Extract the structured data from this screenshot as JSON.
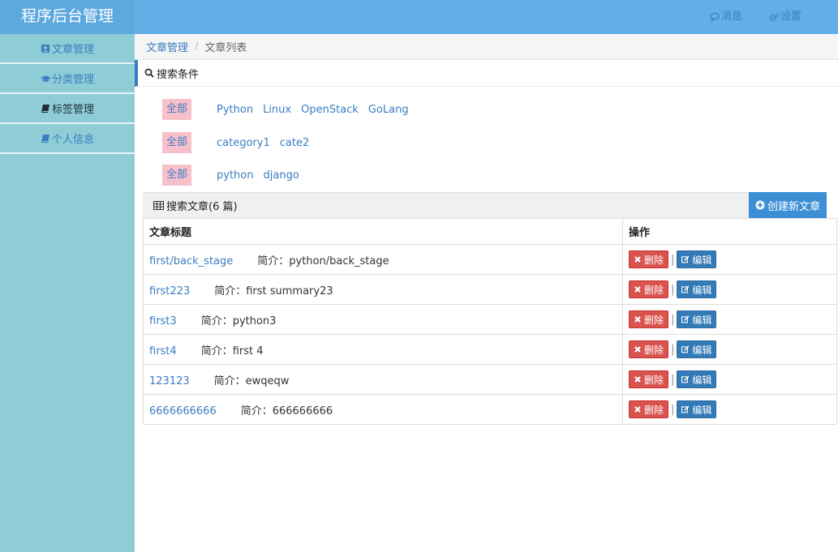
{
  "brand": {
    "title": "程序后台管理"
  },
  "sidebar": {
    "items": [
      {
        "label": "文章管理",
        "icon": "user-square-icon"
      },
      {
        "label": "分类管理",
        "icon": "graduation-cap-icon"
      },
      {
        "label": "标签管理",
        "icon": "book-icon"
      },
      {
        "label": "个人信息",
        "icon": "book-icon"
      }
    ]
  },
  "topbar": {
    "messages_label": "消息",
    "settings_label": "设置"
  },
  "breadcrumb": {
    "parent": "文章管理",
    "separator": "/",
    "current": "文章列表"
  },
  "search": {
    "title": "搜索条件",
    "rows": [
      {
        "all_label": "全部",
        "options": [
          "Python",
          "Linux",
          "OpenStack",
          "GoLang"
        ]
      },
      {
        "all_label": "全部",
        "options": [
          "category1",
          "cate2"
        ]
      },
      {
        "all_label": "全部",
        "options": [
          "python",
          "django"
        ]
      }
    ]
  },
  "article_table": {
    "bar_title": "搜索文章(6 篇)",
    "create_label": "创建新文章",
    "columns": [
      "文章标题",
      "操作"
    ],
    "delete_label": "删除",
    "edit_label": "编辑",
    "rows": [
      {
        "title": "first/back_stage",
        "summary": "简介：python/back_stage"
      },
      {
        "title": "first223",
        "summary": "简介：first summary23"
      },
      {
        "title": "first3",
        "summary": "简介：python3"
      },
      {
        "title": "first4",
        "summary": "简介：first 4"
      },
      {
        "title": "123123",
        "summary": "简介：ewqeqw"
      },
      {
        "title": "6666666666",
        "summary": "简介：666666666"
      }
    ]
  },
  "colors": {
    "sidebar_bg": "#8ecdd6",
    "topbar_bg": "#62aee6",
    "link": "#3a7cc2",
    "chip_bg": "#f7c0ca",
    "danger": "#d9534f",
    "primary": "#337ab7"
  }
}
